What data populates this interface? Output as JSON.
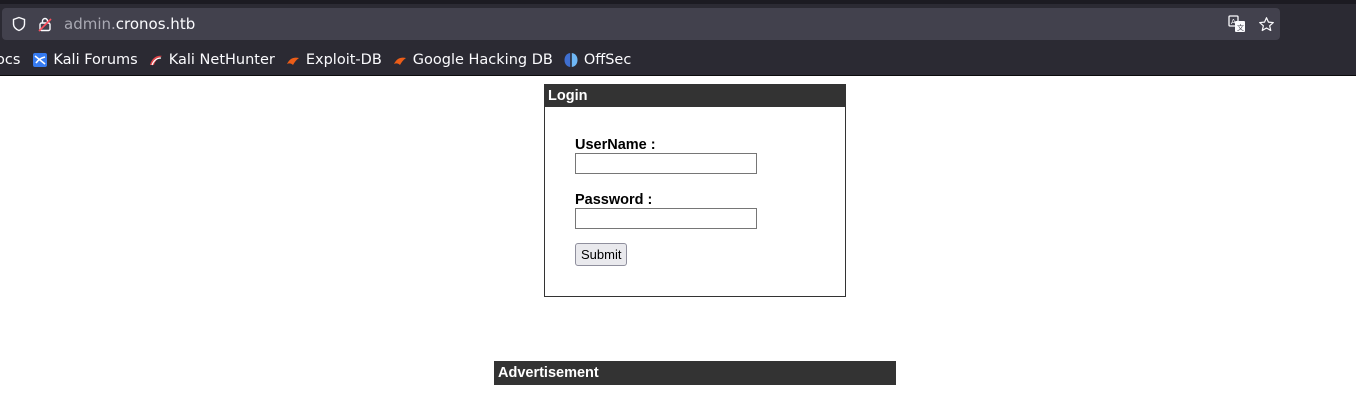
{
  "browser": {
    "url_subdomain": "admin.",
    "url_domain": "cronos.htb",
    "bookmarks": [
      {
        "label": "ocs",
        "icon": "docs-icon"
      },
      {
        "label": "Kali Forums",
        "icon": "kali-forums-icon"
      },
      {
        "label": "Kali NetHunter",
        "icon": "kali-nethunter-icon"
      },
      {
        "label": "Exploit-DB",
        "icon": "exploit-db-icon"
      },
      {
        "label": "Google Hacking DB",
        "icon": "ghdb-icon"
      },
      {
        "label": "OffSec",
        "icon": "offsec-icon"
      }
    ]
  },
  "login": {
    "title": "Login",
    "username_label": "UserName :",
    "username_value": "",
    "password_label": "Password :",
    "password_value": "",
    "submit_label": "Submit"
  },
  "advertisement": {
    "title": "Advertisement"
  }
}
